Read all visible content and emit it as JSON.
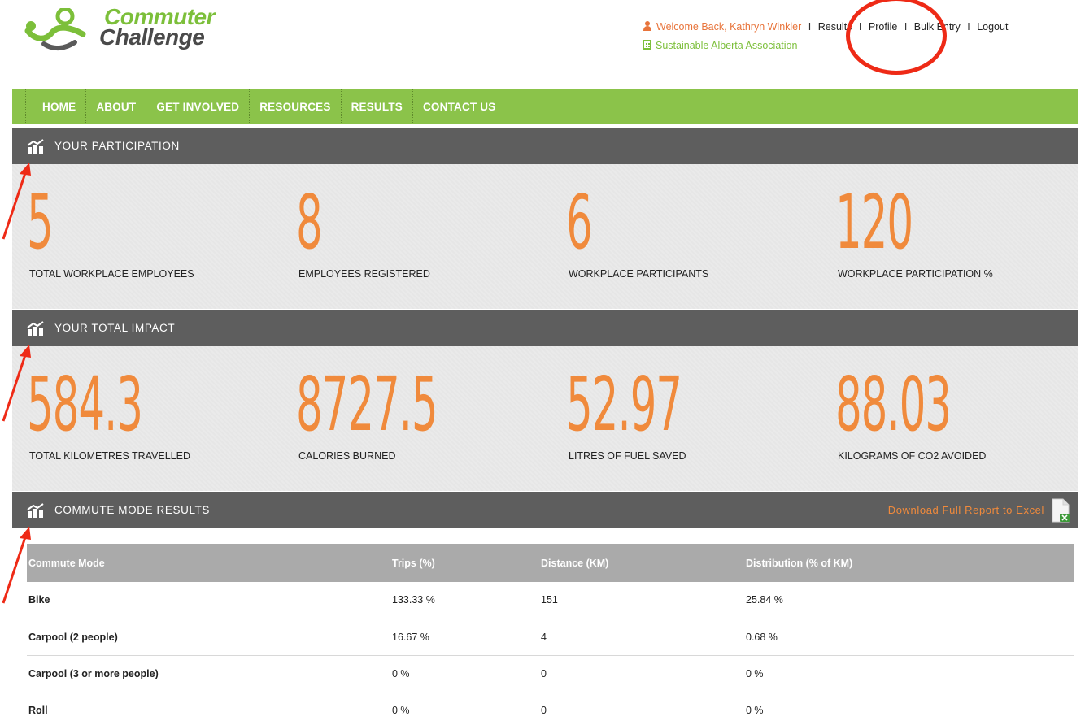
{
  "logo": {
    "line1": "Commuter",
    "line2": "Challenge"
  },
  "header": {
    "welcome": "Welcome Back,  Kathryn Winkler",
    "links": [
      "Results",
      "Profile",
      "Bulk Entry",
      "Logout"
    ],
    "organization": "Sustainable Alberta Association"
  },
  "nav": {
    "items": [
      "HOME",
      "ABOUT",
      "GET INVOLVED",
      "RESOURCES",
      "RESULTS",
      "CONTACT US"
    ]
  },
  "participation": {
    "title": "YOUR PARTICIPATION",
    "stats": [
      {
        "value": "5",
        "label": "TOTAL WORKPLACE EMPLOYEES"
      },
      {
        "value": "8",
        "label": "EMPLOYEES REGISTERED"
      },
      {
        "value": "6",
        "label": "WORKPLACE PARTICIPANTS"
      },
      {
        "value": "120",
        "label": "WORKPLACE PARTICIPATION %"
      }
    ]
  },
  "impact": {
    "title": "YOUR TOTAL IMPACT",
    "stats": [
      {
        "value": "584.3",
        "label": "TOTAL KILOMETRES TRAVELLED"
      },
      {
        "value": "8727.5",
        "label": "CALORIES BURNED"
      },
      {
        "value": "52.97",
        "label": "LITRES OF FUEL SAVED"
      },
      {
        "value": "88.03",
        "label": "KILOGRAMS OF CO2 AVOIDED"
      }
    ]
  },
  "commute": {
    "title": "COMMUTE MODE RESULTS",
    "download_label": "Download Full Report to Excel",
    "columns": [
      "Commute Mode",
      "Trips (%)",
      "Distance (KM)",
      "Distribution (% of KM)"
    ],
    "rows": [
      [
        "Bike",
        "133.33 %",
        "151",
        "25.84 %"
      ],
      [
        "Carpool (2 people)",
        "16.67 %",
        "4",
        "0.68 %"
      ],
      [
        "Carpool (3 or more people)",
        "0 %",
        "0",
        "0 %"
      ],
      [
        "Roll",
        "0 %",
        "0",
        "0 %"
      ]
    ]
  },
  "colors": {
    "brand_green": "#8bc34a",
    "accent_orange": "#f08a3c",
    "section_bar": "#5e5e5e",
    "annotation_red": "#ee2a16"
  }
}
